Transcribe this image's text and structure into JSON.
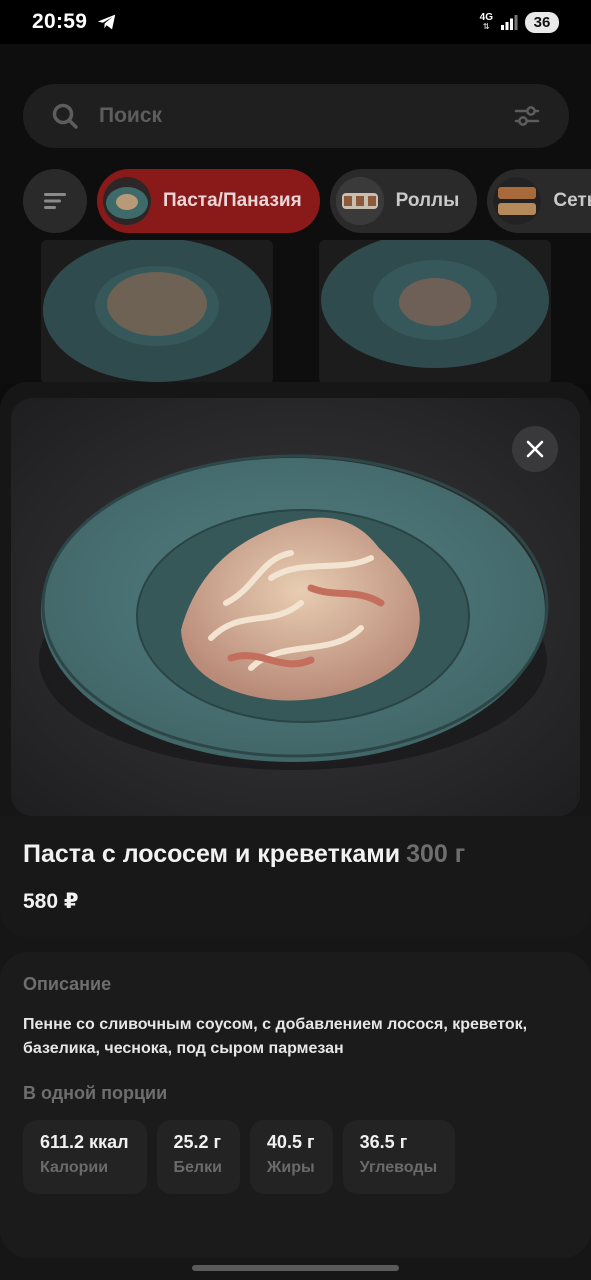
{
  "status_bar": {
    "time": "20:59",
    "network": "4G",
    "battery": "36",
    "icons": [
      "telegram-icon",
      "signal-icon"
    ]
  },
  "search": {
    "placeholder": "Поиск",
    "icons": [
      "search-icon",
      "filter-icon"
    ]
  },
  "categories": {
    "items": [
      {
        "label": "Паста/Паназия",
        "active": true
      },
      {
        "label": "Роллы",
        "active": false
      },
      {
        "label": "Сеты",
        "active": false
      }
    ],
    "menu_icon": "menu-icon",
    "active_color": "#8a1a1a"
  },
  "product": {
    "title": "Паста с лососем и креветками",
    "weight": "300 г",
    "price": "580 ₽"
  },
  "description": {
    "heading": "Описание",
    "text": "Пенне со сливочным соусом, с добавлением лосося, креветок, базелика, чеснока, под сыром пармезан"
  },
  "nutrition": {
    "heading": "В одной порции",
    "items": [
      {
        "value": "611.2 ккал",
        "label": "Калории"
      },
      {
        "value": "25.2 г",
        "label": "Белки"
      },
      {
        "value": "40.5 г",
        "label": "Жиры"
      },
      {
        "value": "36.5 г",
        "label": "Углеводы"
      }
    ]
  },
  "modal": {
    "close_icon": "close-icon"
  }
}
